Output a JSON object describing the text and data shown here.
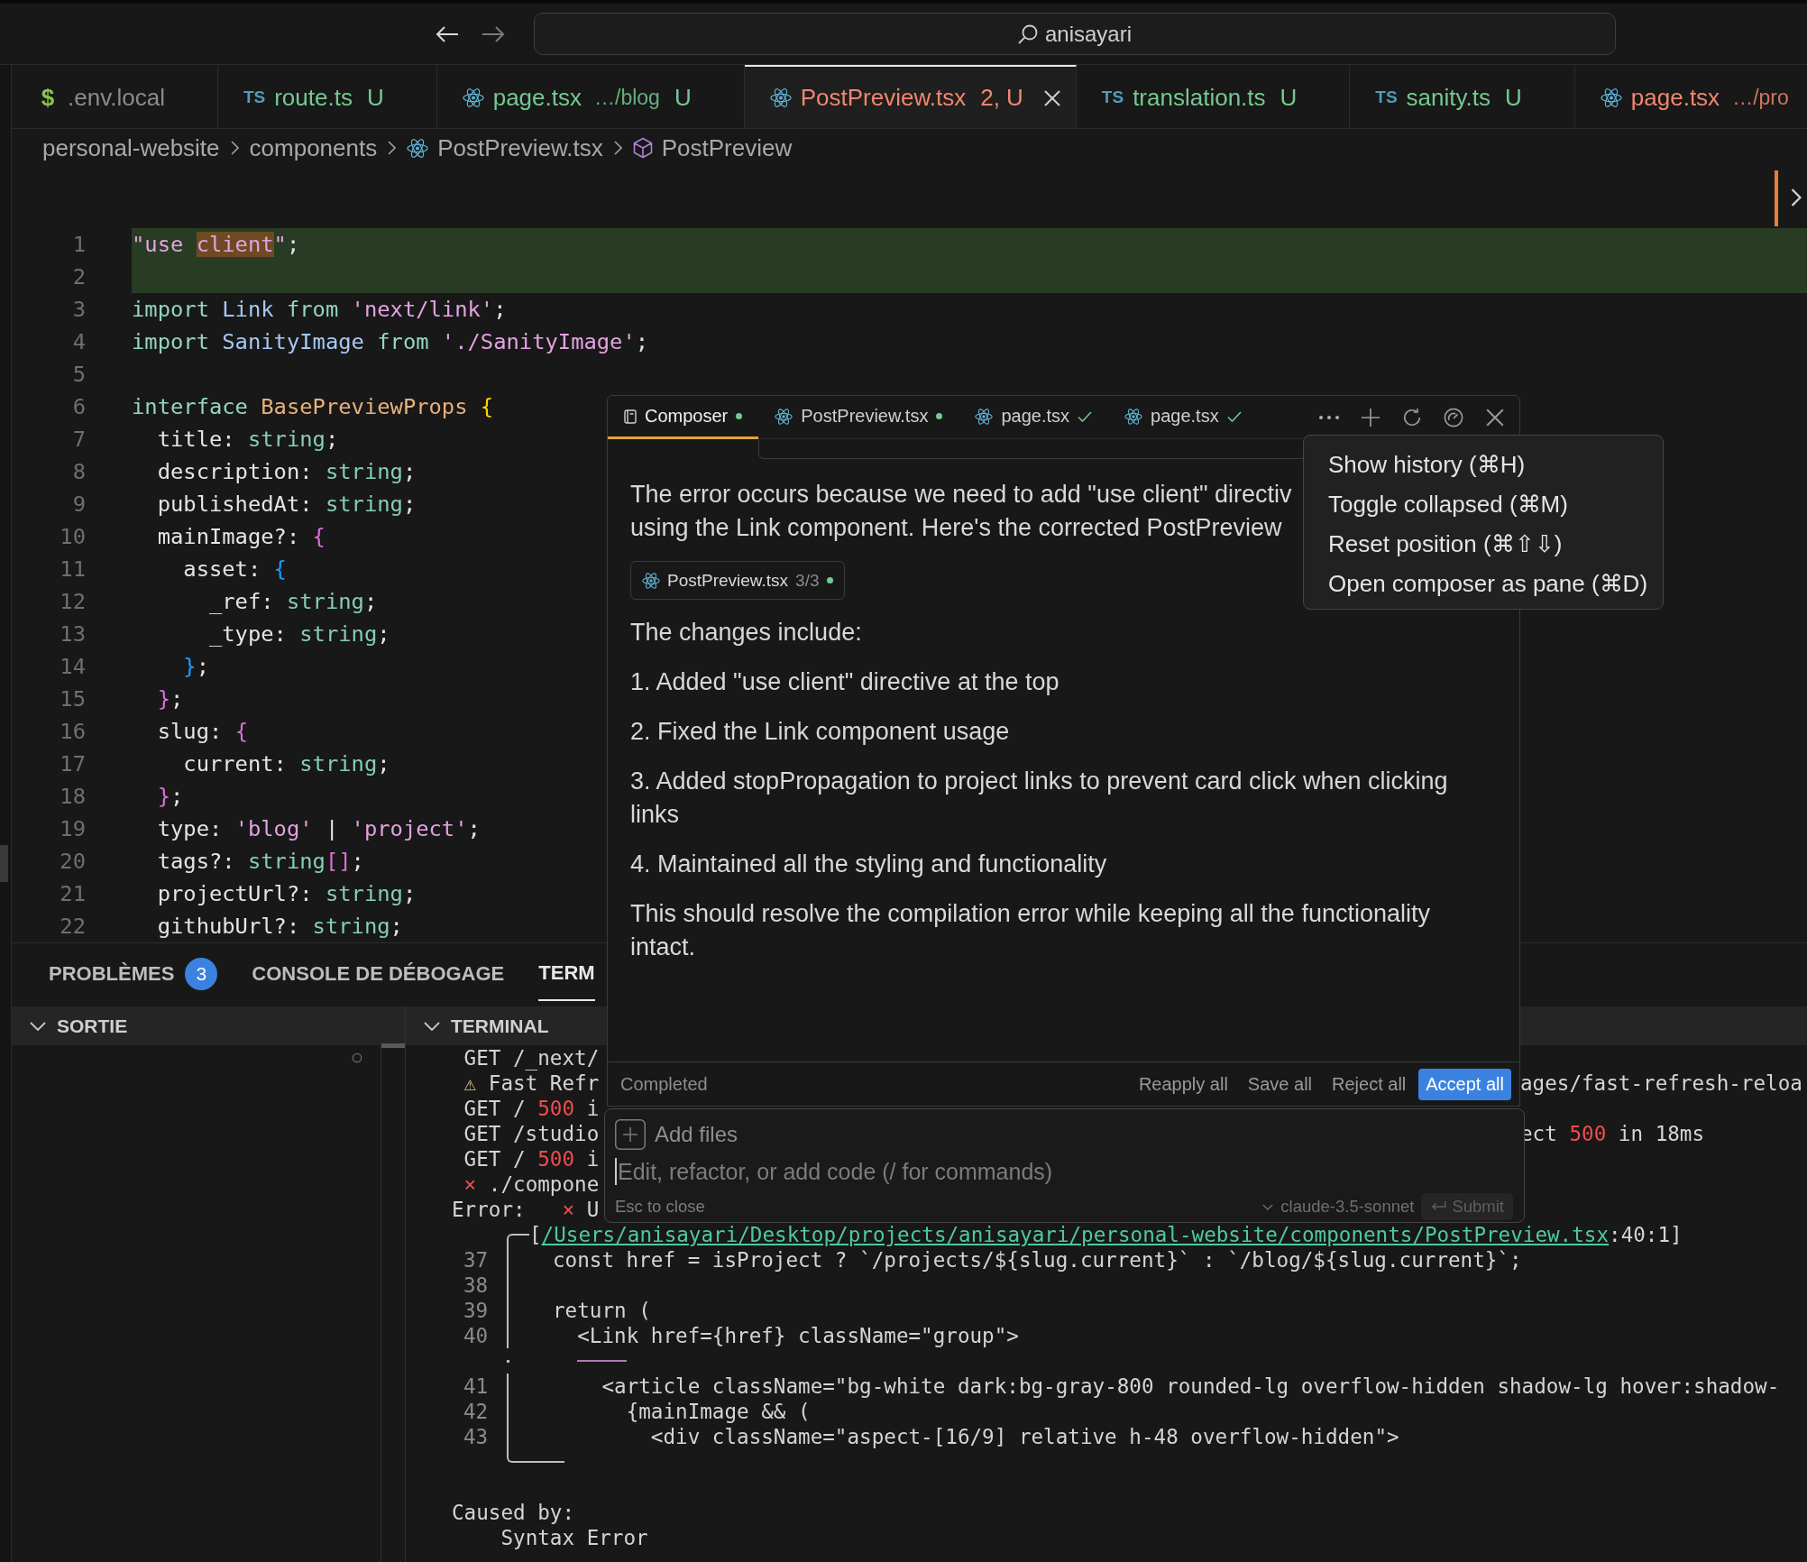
{
  "title_bar": {
    "navigation": [
      {
        "kind": "back",
        "disabled": false
      },
      {
        "kind": "forward",
        "disabled": true
      }
    ],
    "search": "anisayari"
  },
  "tabs": [
    {
      "icon": {
        "kind": "env",
        "text": "$"
      },
      "name": ".env.local",
      "kind": "ignored",
      "selected": false
    },
    {
      "icon": {
        "kind": "ts",
        "text": "TS"
      },
      "name": "route.ts",
      "decoration": "U",
      "kind": "untracked",
      "selected": false
    },
    {
      "icon": {
        "kind": "react"
      },
      "name": "page.tsx",
      "description": "…/blog",
      "decoration": "U",
      "kind": "untracked",
      "selected": false
    },
    {
      "icon": {
        "kind": "react"
      },
      "name": "PostPreview.tsx",
      "decoration": "2, U",
      "kind": "error",
      "selected": true
    },
    {
      "icon": {
        "kind": "ts",
        "text": "TS"
      },
      "name": "translation.ts",
      "decoration": "U",
      "kind": "untracked",
      "selected": false
    },
    {
      "icon": {
        "kind": "ts",
        "text": "TS"
      },
      "name": "sanity.ts",
      "decoration": "U",
      "kind": "untracked",
      "selected": false
    },
    {
      "icon": {
        "kind": "react"
      },
      "name": "page.tsx",
      "description": "…/pro",
      "kind": "error",
      "selected": false
    }
  ],
  "breadcrumb": [
    {
      "label": "personal-website",
      "kind": "folder"
    },
    {
      "label": "components",
      "kind": "folder"
    },
    {
      "label": "PostPreview.tsx",
      "kind": "file"
    },
    {
      "label": "PostPreview",
      "kind": "symbol"
    }
  ],
  "editor": {
    "lines": [
      {
        "number": "1",
        "added": true,
        "tokens": [
          {
            "text": "\"use ",
            "kind": "str"
          },
          {
            "text": "client",
            "kind": "match"
          },
          {
            "text": "\"",
            "kind": "str"
          },
          {
            "text": ";",
            "kind": "p"
          }
        ]
      },
      {
        "number": "2",
        "added": true
      },
      {
        "number": "3",
        "added": false,
        "tokens": [
          {
            "text": "import",
            "kind": "kw"
          },
          {
            "text": " Link ",
            "kind": "id"
          },
          {
            "text": "from",
            "kind": "kw"
          },
          {
            "text": " 'next/link'",
            "kind": "str"
          },
          {
            "text": ";",
            "kind": "p"
          }
        ]
      },
      {
        "number": "4",
        "added": false,
        "tokens": [
          {
            "text": "import",
            "kind": "kw"
          },
          {
            "text": " SanityImage ",
            "kind": "id"
          },
          {
            "text": "from",
            "kind": "kw"
          },
          {
            "text": " './SanityImage'",
            "kind": "str"
          },
          {
            "text": ";",
            "kind": "p"
          }
        ]
      },
      {
        "number": "5",
        "added": false
      },
      {
        "number": "6",
        "added": false,
        "tokens": [
          {
            "text": "interface",
            "kind": "kw"
          },
          {
            "text": " BasePreviewProps ",
            "kind": "cls"
          },
          {
            "text": "{",
            "kind": "b1"
          }
        ]
      },
      {
        "number": "7",
        "added": false,
        "tokens": [
          {
            "text": "  title",
            "kind": "prop"
          },
          {
            "text": ": ",
            "kind": "p"
          },
          {
            "text": "string",
            "kind": "type"
          },
          {
            "text": ";",
            "kind": "p"
          }
        ]
      },
      {
        "number": "8",
        "added": false,
        "tokens": [
          {
            "text": "  description",
            "kind": "prop"
          },
          {
            "text": ": ",
            "kind": "p"
          },
          {
            "text": "string",
            "kind": "type"
          },
          {
            "text": ";",
            "kind": "p"
          }
        ]
      },
      {
        "number": "9",
        "added": false,
        "tokens": [
          {
            "text": "  publishedAt",
            "kind": "prop"
          },
          {
            "text": ": ",
            "kind": "p"
          },
          {
            "text": "string",
            "kind": "type"
          },
          {
            "text": ";",
            "kind": "p"
          }
        ]
      },
      {
        "number": "10",
        "added": false,
        "tokens": [
          {
            "text": "  mainImage",
            "kind": "prop"
          },
          {
            "text": "?: ",
            "kind": "p"
          },
          {
            "text": "{",
            "kind": "b2"
          }
        ]
      },
      {
        "number": "11",
        "added": false,
        "tokens": [
          {
            "text": "    asset",
            "kind": "prop"
          },
          {
            "text": ": ",
            "kind": "p"
          },
          {
            "text": "{",
            "kind": "b3"
          }
        ]
      },
      {
        "number": "12",
        "added": false,
        "tokens": [
          {
            "text": "      _ref",
            "kind": "prop"
          },
          {
            "text": ": ",
            "kind": "p"
          },
          {
            "text": "string",
            "kind": "type"
          },
          {
            "text": ";",
            "kind": "p"
          }
        ]
      },
      {
        "number": "13",
        "added": false,
        "tokens": [
          {
            "text": "      _type",
            "kind": "prop"
          },
          {
            "text": ": ",
            "kind": "p"
          },
          {
            "text": "string",
            "kind": "type"
          },
          {
            "text": ";",
            "kind": "p"
          }
        ]
      },
      {
        "number": "14",
        "added": false,
        "tokens": [
          {
            "text": "    }",
            "kind": "b3"
          },
          {
            "text": ";",
            "kind": "p"
          }
        ]
      },
      {
        "number": "15",
        "added": false,
        "tokens": [
          {
            "text": "  }",
            "kind": "b2"
          },
          {
            "text": ";",
            "kind": "p"
          }
        ]
      },
      {
        "number": "16",
        "added": false,
        "tokens": [
          {
            "text": "  slug",
            "kind": "prop"
          },
          {
            "text": ": ",
            "kind": "p"
          },
          {
            "text": "{",
            "kind": "b2"
          }
        ]
      },
      {
        "number": "17",
        "added": false,
        "tokens": [
          {
            "text": "    current",
            "kind": "prop"
          },
          {
            "text": ": ",
            "kind": "p"
          },
          {
            "text": "string",
            "kind": "type"
          },
          {
            "text": ";",
            "kind": "p"
          }
        ]
      },
      {
        "number": "18",
        "added": false,
        "tokens": [
          {
            "text": "  }",
            "kind": "b2"
          },
          {
            "text": ";",
            "kind": "p"
          }
        ]
      },
      {
        "number": "19",
        "added": false,
        "tokens": [
          {
            "text": "  type",
            "kind": "prop"
          },
          {
            "text": ": ",
            "kind": "p"
          },
          {
            "text": "'blog'",
            "kind": "str"
          },
          {
            "text": " | ",
            "kind": "p"
          },
          {
            "text": "'project'",
            "kind": "str"
          },
          {
            "text": ";",
            "kind": "p"
          }
        ]
      },
      {
        "number": "20",
        "added": false,
        "tokens": [
          {
            "text": "  tags",
            "kind": "prop"
          },
          {
            "text": "?: ",
            "kind": "p"
          },
          {
            "text": "string",
            "kind": "type"
          },
          {
            "text": "[]",
            "kind": "b2"
          },
          {
            "text": ";",
            "kind": "p"
          }
        ]
      },
      {
        "number": "21",
        "added": false,
        "tokens": [
          {
            "text": "  projectUrl",
            "kind": "prop"
          },
          {
            "text": "?: ",
            "kind": "p"
          },
          {
            "text": "string",
            "kind": "type"
          },
          {
            "text": ";",
            "kind": "p"
          }
        ]
      },
      {
        "number": "22",
        "added": false,
        "tokens": [
          {
            "text": "  githubUrl",
            "kind": "prop"
          },
          {
            "text": "?: ",
            "kind": "p"
          },
          {
            "text": "string",
            "kind": "type"
          },
          {
            "text": ";",
            "kind": "p"
          }
        ]
      }
    ]
  },
  "panel": {
    "tabs": [
      {
        "label": "PROBLÈMES",
        "badge": "3",
        "selected": false
      },
      {
        "label": "CONSOLE DE DÉBOGAGE",
        "selected": false
      },
      {
        "label": "TERM",
        "selected": true
      }
    ],
    "sections": [
      {
        "title": "SORTIE",
        "expanded": true
      },
      {
        "title": "TERMINAL",
        "expanded": true
      }
    ]
  },
  "terminal": {
    "lines": [
      {
        "left": [
          {
            "text": " GET /_next/",
            "kind": "plain"
          }
        ]
      },
      {
        "left": [
          {
            "text": " ⚠",
            "kind": "warn"
          },
          {
            "text": " Fast Refr",
            "kind": "plain"
          }
        ],
        "right": [
          {
            "text": "ages/fast-refresh-reloa",
            "kind": "plain"
          }
        ]
      },
      {
        "left": [
          {
            "text": " GET / ",
            "kind": "plain"
          },
          {
            "text": "500",
            "kind": "error"
          },
          {
            "text": " i",
            "kind": "plain"
          }
        ]
      },
      {
        "left": [
          {
            "text": " GET /studio",
            "kind": "plain"
          }
        ],
        "right": [
          {
            "text": "ect ",
            "kind": "plain"
          },
          {
            "text": "500",
            "kind": "error"
          },
          {
            "text": " in 18ms",
            "kind": "plain"
          }
        ]
      },
      {
        "left": [
          {
            "text": " GET / ",
            "kind": "plain"
          },
          {
            "text": "500",
            "kind": "error"
          },
          {
            "text": " i",
            "kind": "plain"
          }
        ]
      },
      {
        "left": [
          {
            "text": " ×",
            "kind": "error"
          },
          {
            "text": " ./compone",
            "kind": "plain"
          }
        ]
      },
      {
        "left": [
          {
            "text": "Error:   ",
            "kind": "plain"
          },
          {
            "text": "×",
            "kind": "error"
          },
          {
            "text": " U",
            "kind": "plain"
          }
        ]
      }
    ],
    "snippet": {
      "location": {
        "open": "[",
        "path": "/Users/anisayari/Desktop/projects/anisayari/personal-website/components/PostPreview.tsx",
        "close": ":40:1]"
      },
      "lines": [
        {
          "number": "37",
          "code": "const href = isProject ? `/projects/${slug.current}` : `/blog/${slug.current}`;",
          "marked": false
        },
        {
          "number": "38",
          "marked": false
        },
        {
          "number": "39",
          "code": "return (",
          "marked": false
        },
        {
          "number": "40",
          "code": "  <Link href={href} className=\"group\">",
          "marked": true
        },
        {
          "number": "41",
          "code": "    <article className=\"bg-white dark:bg-gray-800 rounded-lg overflow-hidden shadow-lg hover:shadow-",
          "marked": false
        },
        {
          "number": "42",
          "code": "      {mainImage && (",
          "marked": false
        },
        {
          "number": "43",
          "code": "        <div className=\"aspect-[16/9] relative h-48 overflow-hidden\">",
          "marked": false
        }
      ]
    },
    "cause": {
      "title": "Caused by:",
      "detail": "    Syntax Error"
    }
  },
  "composer": {
    "tabs": [
      {
        "label": "Composer",
        "kind": "composer",
        "pending": true,
        "selected": true
      },
      {
        "label": "PostPreview.tsx",
        "kind": "file",
        "pending": true,
        "selected": false
      },
      {
        "label": "page.tsx",
        "kind": "file",
        "pending": false,
        "selected": false
      },
      {
        "label": "page.tsx",
        "kind": "file",
        "pending": false,
        "selected": false
      }
    ],
    "intro_lines": [
      "The error occurs because we need to add \"use client\" directiv",
      "using the Link component. Here's the corrected PostPreview"
    ],
    "file_chip": {
      "name": "PostPreview.tsx",
      "count": "3/3",
      "pending": true
    },
    "heading": "The changes include:",
    "items": [
      "1. Added \"use client\" directive at the top",
      "2. Fixed the Link component usage",
      "3. Added stopPropagation to project links to prevent card click when clicking links",
      "4. Maintained all the styling and functionality"
    ],
    "summary": "This should resolve the compilation error while keeping all the functionality intact.",
    "status": "Completed",
    "actions": [
      {
        "label": "Reapply all",
        "primary": false
      },
      {
        "label": "Save all",
        "primary": false
      },
      {
        "label": "Reject all",
        "primary": false
      },
      {
        "label": "Accept all",
        "primary": true
      }
    ],
    "input": {
      "add_files": "Add files",
      "placeholder": "Edit, refactor, or add code (/ for commands)",
      "hint": "Esc to close",
      "model": "claude-3.5-sonnet",
      "submit": "Submit"
    }
  },
  "menu": {
    "items": [
      "Show history (⌘H)",
      "Toggle collapsed (⌘M)",
      "Reset position (⌘⇧⇩)",
      "Open composer as pane (⌘D)"
    ]
  }
}
